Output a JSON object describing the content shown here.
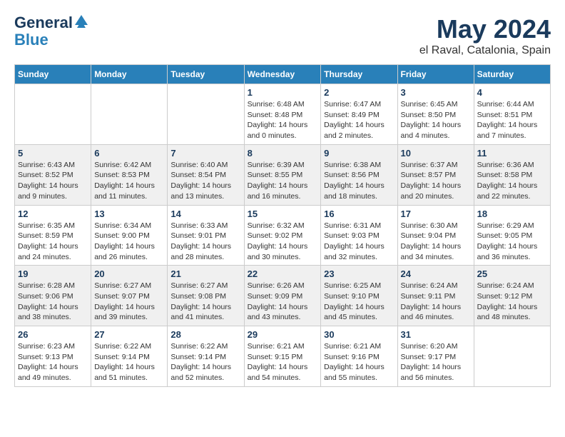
{
  "logo": {
    "general": "General",
    "blue": "Blue"
  },
  "title": "May 2024",
  "subtitle": "el Raval, Catalonia, Spain",
  "headers": [
    "Sunday",
    "Monday",
    "Tuesday",
    "Wednesday",
    "Thursday",
    "Friday",
    "Saturday"
  ],
  "weeks": [
    [
      {
        "day": "",
        "info": ""
      },
      {
        "day": "",
        "info": ""
      },
      {
        "day": "",
        "info": ""
      },
      {
        "day": "1",
        "info": "Sunrise: 6:48 AM\nSunset: 8:48 PM\nDaylight: 14 hours\nand 0 minutes."
      },
      {
        "day": "2",
        "info": "Sunrise: 6:47 AM\nSunset: 8:49 PM\nDaylight: 14 hours\nand 2 minutes."
      },
      {
        "day": "3",
        "info": "Sunrise: 6:45 AM\nSunset: 8:50 PM\nDaylight: 14 hours\nand 4 minutes."
      },
      {
        "day": "4",
        "info": "Sunrise: 6:44 AM\nSunset: 8:51 PM\nDaylight: 14 hours\nand 7 minutes."
      }
    ],
    [
      {
        "day": "5",
        "info": "Sunrise: 6:43 AM\nSunset: 8:52 PM\nDaylight: 14 hours\nand 9 minutes."
      },
      {
        "day": "6",
        "info": "Sunrise: 6:42 AM\nSunset: 8:53 PM\nDaylight: 14 hours\nand 11 minutes."
      },
      {
        "day": "7",
        "info": "Sunrise: 6:40 AM\nSunset: 8:54 PM\nDaylight: 14 hours\nand 13 minutes."
      },
      {
        "day": "8",
        "info": "Sunrise: 6:39 AM\nSunset: 8:55 PM\nDaylight: 14 hours\nand 16 minutes."
      },
      {
        "day": "9",
        "info": "Sunrise: 6:38 AM\nSunset: 8:56 PM\nDaylight: 14 hours\nand 18 minutes."
      },
      {
        "day": "10",
        "info": "Sunrise: 6:37 AM\nSunset: 8:57 PM\nDaylight: 14 hours\nand 20 minutes."
      },
      {
        "day": "11",
        "info": "Sunrise: 6:36 AM\nSunset: 8:58 PM\nDaylight: 14 hours\nand 22 minutes."
      }
    ],
    [
      {
        "day": "12",
        "info": "Sunrise: 6:35 AM\nSunset: 8:59 PM\nDaylight: 14 hours\nand 24 minutes."
      },
      {
        "day": "13",
        "info": "Sunrise: 6:34 AM\nSunset: 9:00 PM\nDaylight: 14 hours\nand 26 minutes."
      },
      {
        "day": "14",
        "info": "Sunrise: 6:33 AM\nSunset: 9:01 PM\nDaylight: 14 hours\nand 28 minutes."
      },
      {
        "day": "15",
        "info": "Sunrise: 6:32 AM\nSunset: 9:02 PM\nDaylight: 14 hours\nand 30 minutes."
      },
      {
        "day": "16",
        "info": "Sunrise: 6:31 AM\nSunset: 9:03 PM\nDaylight: 14 hours\nand 32 minutes."
      },
      {
        "day": "17",
        "info": "Sunrise: 6:30 AM\nSunset: 9:04 PM\nDaylight: 14 hours\nand 34 minutes."
      },
      {
        "day": "18",
        "info": "Sunrise: 6:29 AM\nSunset: 9:05 PM\nDaylight: 14 hours\nand 36 minutes."
      }
    ],
    [
      {
        "day": "19",
        "info": "Sunrise: 6:28 AM\nSunset: 9:06 PM\nDaylight: 14 hours\nand 38 minutes."
      },
      {
        "day": "20",
        "info": "Sunrise: 6:27 AM\nSunset: 9:07 PM\nDaylight: 14 hours\nand 39 minutes."
      },
      {
        "day": "21",
        "info": "Sunrise: 6:27 AM\nSunset: 9:08 PM\nDaylight: 14 hours\nand 41 minutes."
      },
      {
        "day": "22",
        "info": "Sunrise: 6:26 AM\nSunset: 9:09 PM\nDaylight: 14 hours\nand 43 minutes."
      },
      {
        "day": "23",
        "info": "Sunrise: 6:25 AM\nSunset: 9:10 PM\nDaylight: 14 hours\nand 45 minutes."
      },
      {
        "day": "24",
        "info": "Sunrise: 6:24 AM\nSunset: 9:11 PM\nDaylight: 14 hours\nand 46 minutes."
      },
      {
        "day": "25",
        "info": "Sunrise: 6:24 AM\nSunset: 9:12 PM\nDaylight: 14 hours\nand 48 minutes."
      }
    ],
    [
      {
        "day": "26",
        "info": "Sunrise: 6:23 AM\nSunset: 9:13 PM\nDaylight: 14 hours\nand 49 minutes."
      },
      {
        "day": "27",
        "info": "Sunrise: 6:22 AM\nSunset: 9:14 PM\nDaylight: 14 hours\nand 51 minutes."
      },
      {
        "day": "28",
        "info": "Sunrise: 6:22 AM\nSunset: 9:14 PM\nDaylight: 14 hours\nand 52 minutes."
      },
      {
        "day": "29",
        "info": "Sunrise: 6:21 AM\nSunset: 9:15 PM\nDaylight: 14 hours\nand 54 minutes."
      },
      {
        "day": "30",
        "info": "Sunrise: 6:21 AM\nSunset: 9:16 PM\nDaylight: 14 hours\nand 55 minutes."
      },
      {
        "day": "31",
        "info": "Sunrise: 6:20 AM\nSunset: 9:17 PM\nDaylight: 14 hours\nand 56 minutes."
      },
      {
        "day": "",
        "info": ""
      }
    ]
  ]
}
